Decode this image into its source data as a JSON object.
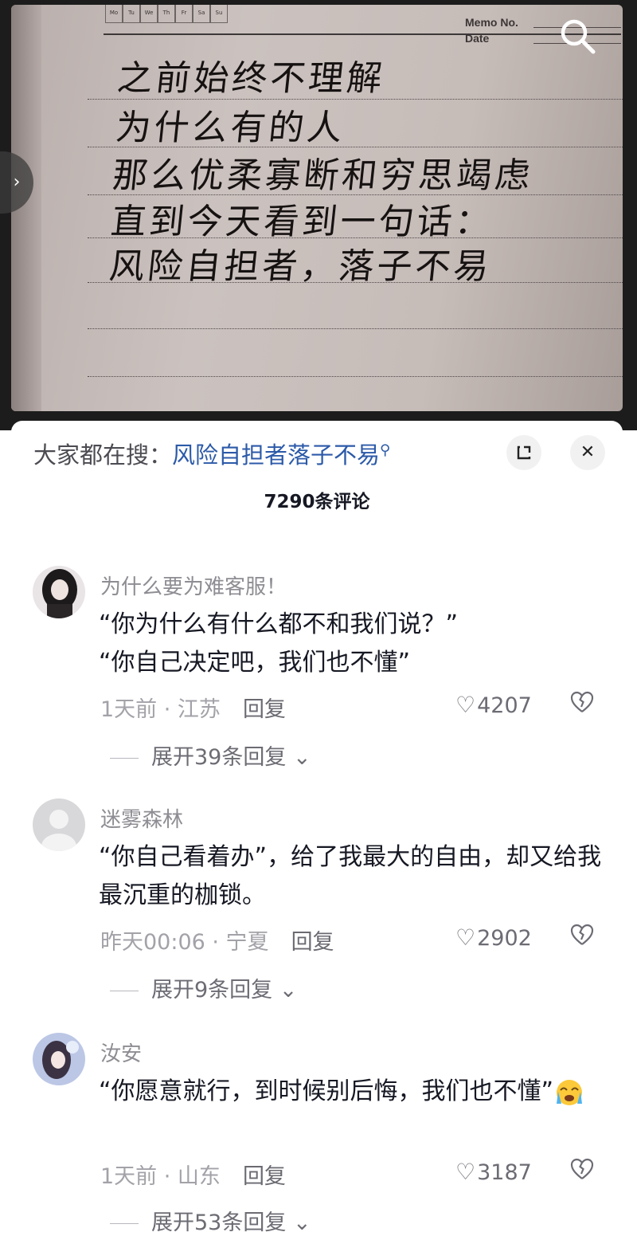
{
  "photo": {
    "weekdays": [
      "Mo",
      "Tu",
      "We",
      "Th",
      "Fr",
      "Sa",
      "Su"
    ],
    "memo_label": "Memo No.",
    "date_label": "Date",
    "handwriting": [
      "之前始终不理解",
      "为什么有的人",
      "那么优柔寡断和穷思竭虑",
      "直到今天看到一句话：",
      "风险自担者，落子不易"
    ]
  },
  "search_suggest": {
    "prefix": "大家都在搜：",
    "term": "风险自担者落子不易"
  },
  "comments_header": {
    "count_label": "7290条评论"
  },
  "comments": [
    {
      "username": "为什么要为难客服！",
      "text": "“你为什么有什么都不和我们说？”\n“你自己决定吧，我们也不懂”",
      "time_location": "1天前 · 江苏",
      "reply_label": "回复",
      "likes": "4207",
      "expand_label": "展开39条回复"
    },
    {
      "username": "迷雾森林",
      "text": "“你自己看着办”，给了我最大的自由，却又给我最沉重的枷锁。",
      "time_location": "昨天00:06 · 宁夏",
      "reply_label": "回复",
      "likes": "2902",
      "expand_label": "展开9条回复"
    },
    {
      "username": "汝安",
      "text": "“你愿意就行，到时候别后悔，我们也不懂”",
      "time_location": "1天前 · 山东",
      "reply_label": "回复",
      "likes": "3187",
      "expand_label": "展开53条回复"
    }
  ],
  "icons": {
    "search": "search-icon",
    "minimize": "collapse-icon",
    "close": "close-icon",
    "like": "heart-outline-icon",
    "dislike": "broken-heart-icon",
    "expand": "chevron-down-icon",
    "emoji": "crying-face-emoji"
  },
  "colors": {
    "search_term": "#2c5aa8",
    "meta": "#a2a2a8",
    "text": "#161823"
  }
}
